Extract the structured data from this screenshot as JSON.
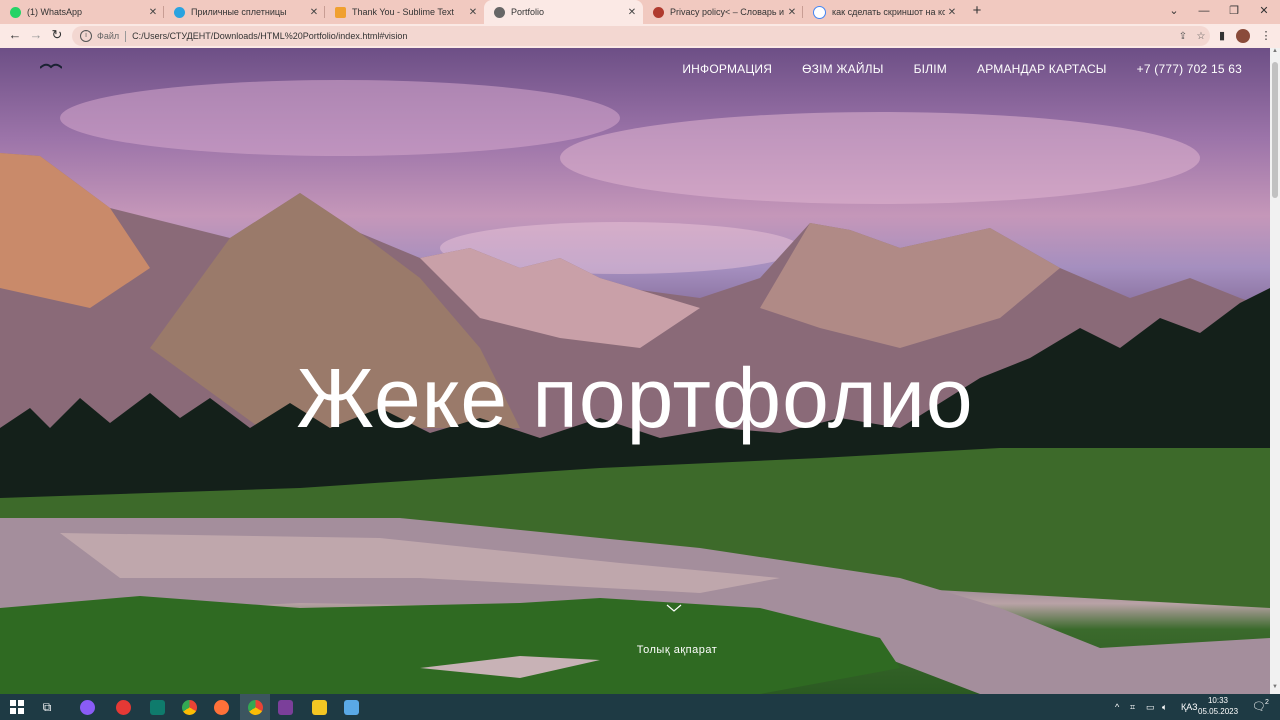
{
  "browser": {
    "tabs": [
      {
        "title": "(1) WhatsApp",
        "color": "#25d366"
      },
      {
        "title": "Приличные сплетницы",
        "color": "#2aa3e0"
      },
      {
        "title": "Thank You - Sublime Text",
        "color": "#f0a030"
      },
      {
        "title": "Portfolio",
        "color": "#666666"
      },
      {
        "title": "Privacy policy< – Словарь и онл",
        "color": "#b03a2e"
      },
      {
        "title": "как сделать скриншот на комп",
        "color": "#ffffff"
      }
    ],
    "address": {
      "label": "Файл",
      "url": "C:/Users/СТУДЕНТ/Downloads/HTML%20Portfolio/index.html#vision"
    }
  },
  "site": {
    "nav": [
      "ИНФОРМАЦИЯ",
      "ӨЗІМ ЖАЙЛЫ",
      "БІЛІМ",
      "АРМАНДАР КАРТАСЫ",
      "+7 (777) 702 15 63"
    ],
    "hero_title": "Жеке портфолио",
    "more_link": "Толық ақпарат"
  },
  "taskbar": {
    "language": "ҚАЗ",
    "time": "10:33",
    "date": "05.05.2023",
    "notification_count": "2"
  }
}
